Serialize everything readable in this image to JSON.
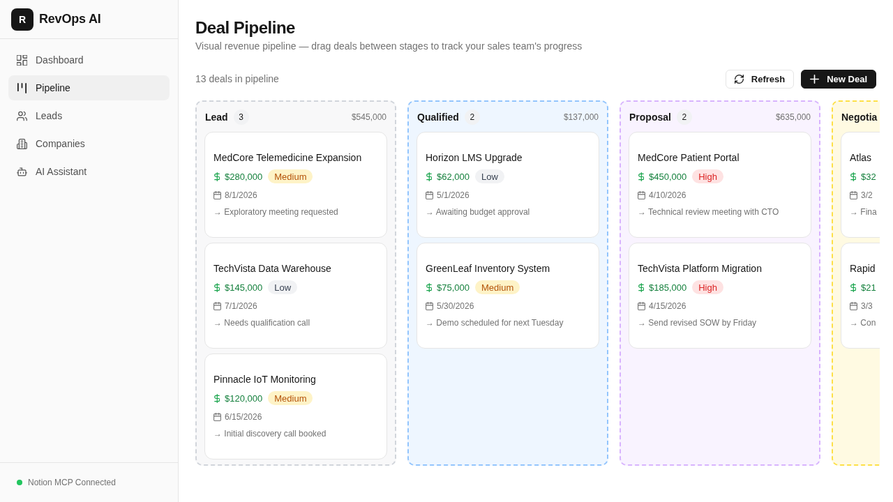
{
  "sidebar": {
    "logo_letter": "R",
    "brand": "RevOps AI",
    "nav": [
      {
        "label": "Dashboard",
        "selected": false
      },
      {
        "label": "Pipeline",
        "selected": true
      },
      {
        "label": "Leads",
        "selected": false
      },
      {
        "label": "Companies",
        "selected": false
      },
      {
        "label": "AI Assistant",
        "selected": false
      }
    ],
    "status": {
      "label": "Notion MCP Connected",
      "connected": true
    }
  },
  "header": {
    "title": "Deal Pipeline",
    "subtitle": "Visual revenue pipeline — drag deals between stages to track your sales team's progress"
  },
  "toolbar": {
    "summary": "13 deals in pipeline",
    "buttons": [
      {
        "label": "Refresh",
        "kind": "outline"
      },
      {
        "label": "New Deal",
        "kind": "solid"
      }
    ]
  },
  "stages": [
    {
      "name": "Lead",
      "count": "3",
      "total": "$545,000",
      "color": "#d1d5db",
      "deals": [
        {
          "title": "MedCore Telemedicine Expansion",
          "amount": "$280,000",
          "priority": {
            "label": "Medium",
            "kind": "medium"
          },
          "date": "8/1/2026",
          "note": "→ Exploratory meeting requested"
        },
        {
          "title": "TechVista Data Warehouse",
          "amount": "$145,000",
          "priority": {
            "label": "Low",
            "kind": "low"
          },
          "date": "7/1/2026",
          "note": "→ Needs qualification call"
        },
        {
          "title": "Pinnacle IoT Monitoring",
          "amount": "$120,000",
          "priority": {
            "label": "Medium",
            "kind": "medium"
          },
          "date": "6/15/2026",
          "note": "→ Initial discovery call booked"
        }
      ]
    },
    {
      "name": "Qualified",
      "count": "2",
      "total": "$137,000",
      "color": "#93c5fd",
      "deals": [
        {
          "title": "Horizon LMS Upgrade",
          "amount": "$62,000",
          "priority": {
            "label": "Low",
            "kind": "low"
          },
          "date": "5/1/2026",
          "note": "→ Awaiting budget approval"
        },
        {
          "title": "GreenLeaf Inventory System",
          "amount": "$75,000",
          "priority": {
            "label": "Medium",
            "kind": "medium"
          },
          "date": "5/30/2026",
          "note": "→ Demo scheduled for next Tuesday"
        }
      ]
    },
    {
      "name": "Proposal",
      "count": "2",
      "total": "$635,000",
      "color": "#d8b4fe",
      "deals": [
        {
          "title": "MedCore Patient Portal",
          "amount": "$450,000",
          "priority": {
            "label": "High",
            "kind": "high"
          },
          "date": "4/10/2026",
          "note": "→ Technical review meeting with CTO"
        },
        {
          "title": "TechVista Platform Migration",
          "amount": "$185,000",
          "priority": {
            "label": "High",
            "kind": "high"
          },
          "date": "4/15/2026",
          "note": "→ Send revised SOW by Friday"
        }
      ]
    },
    {
      "name": "Negotia",
      "color": "#fde047",
      "deals": [
        {
          "title": "Atlas",
          "amount": "$32",
          "date": "3/2",
          "note": "→ Fina"
        },
        {
          "title": "Rapid",
          "amount": "$21",
          "date": "3/3",
          "note": "→ Con"
        }
      ]
    }
  ]
}
